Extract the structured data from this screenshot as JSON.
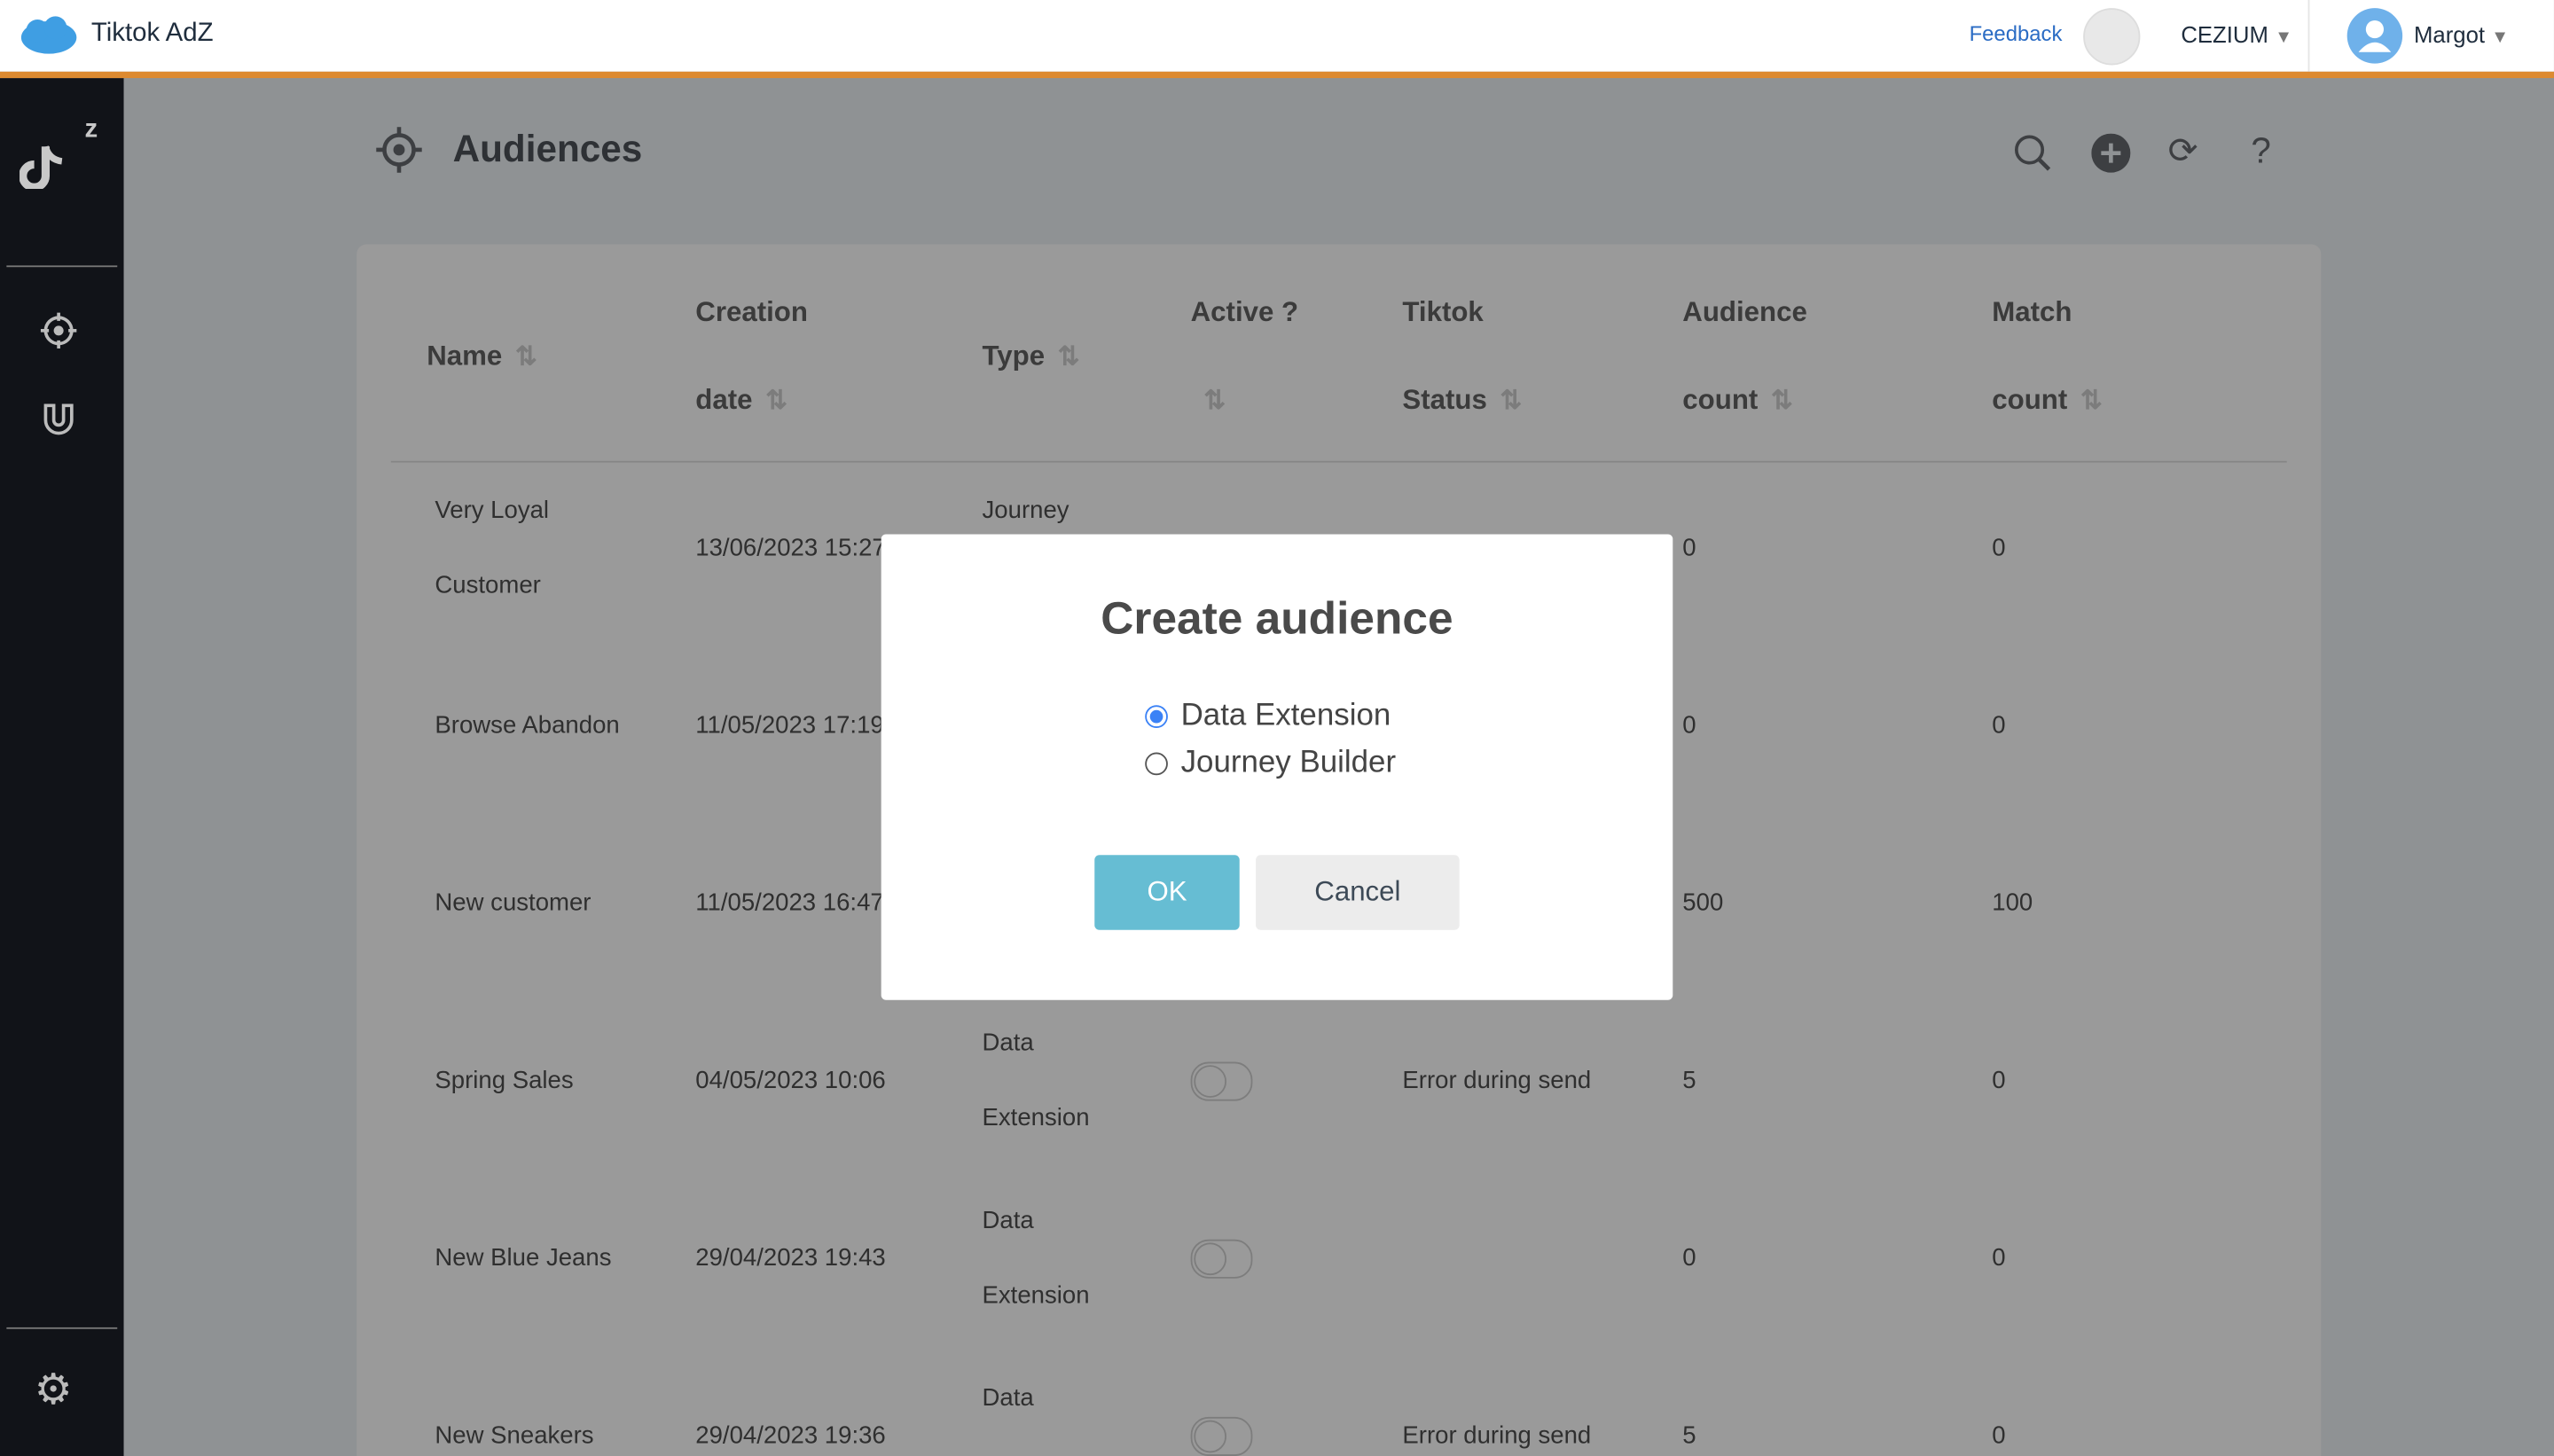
{
  "header": {
    "app_title": "Tiktok AdZ",
    "feedback": "Feedback",
    "org": "CEZIUM",
    "user": "Margot"
  },
  "colors": {
    "accent_orange": "#dd8a30",
    "sidebar": "#111318",
    "primary_button": "#66bdd3",
    "radio": "#3b82f6",
    "feedback_link": "#2b6cc4"
  },
  "page": {
    "title": "Audiences"
  },
  "table": {
    "headers": [
      {
        "line1": "Name",
        "line2": ""
      },
      {
        "line1": "Creation",
        "line2": "date"
      },
      {
        "line1": "Type",
        "line2": ""
      },
      {
        "line1": "Active ?",
        "line2": ""
      },
      {
        "line1": "Tiktok",
        "line2": "Status"
      },
      {
        "line1": "Audience",
        "line2": "count"
      },
      {
        "line1": "Match",
        "line2": "count"
      }
    ],
    "rows": [
      {
        "name1": "Very Loyal",
        "name2": "Customer",
        "date": "13/06/2023 15:27",
        "type1": "Journey",
        "type2": "",
        "status": "",
        "audience": "0",
        "match": "0",
        "active": true
      },
      {
        "name1": "Browse Abandon",
        "name2": "",
        "date": "11/05/2023 17:19",
        "type1": "",
        "type2": "",
        "status": "",
        "audience": "0",
        "match": "0",
        "active": false
      },
      {
        "name1": "New customer",
        "name2": "",
        "date": "11/05/2023 16:47",
        "type1": "",
        "type2": "",
        "status": "",
        "audience": "500",
        "match": "100",
        "active": false
      },
      {
        "name1": "Spring Sales",
        "name2": "",
        "date": "04/05/2023 10:06",
        "type1": "Data",
        "type2": "Extension",
        "status": "Error during send",
        "audience": "5",
        "match": "0",
        "active": false
      },
      {
        "name1": "New Blue Jeans",
        "name2": "",
        "date": "29/04/2023 19:43",
        "type1": "Data",
        "type2": "Extension",
        "status": "",
        "audience": "0",
        "match": "0",
        "active": false
      },
      {
        "name1": "New Sneakers",
        "name2": "",
        "date": "29/04/2023 19:36",
        "type1": "Data",
        "type2": "",
        "status": "Error during send",
        "audience": "5",
        "match": "0",
        "active": false
      }
    ]
  },
  "modal": {
    "title": "Create audience",
    "options": [
      {
        "label": "Data Extension",
        "selected": true
      },
      {
        "label": "Journey Builder",
        "selected": false
      }
    ],
    "ok": "OK",
    "cancel": "Cancel"
  }
}
